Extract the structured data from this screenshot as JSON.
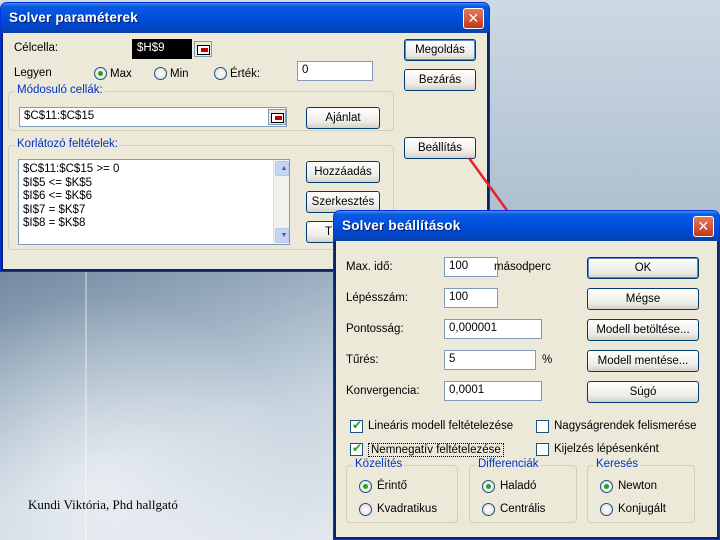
{
  "footer": {
    "caption": "Kundi Viktória, Phd hallgató"
  },
  "solver": {
    "title": "Solver paraméterek",
    "target_label": "Célcella:",
    "target_value": "$H$9",
    "equal_label": "Legyen",
    "max_label": "Max",
    "min_label": "Min",
    "value_label": "Érték:",
    "value_input": "0",
    "changing_label": "Módosuló cellák:",
    "changing_value": "$C$11:$C$15",
    "guess_button": "Ajánlat",
    "constraints_label": "Korlátozó feltételek:",
    "constraints": [
      "$C$11:$C$15 >= 0",
      "$I$5 <= $K$5",
      "$I$6 <= $K$6",
      "$I$7 = $K$7",
      "$I$8 = $K$8"
    ],
    "add_button": "Hozzáadás",
    "change_button": "Szerkesztés",
    "delete_button": "T",
    "solve_button": "Megoldás",
    "close_button": "Bezárás",
    "options_button": "Beállítás"
  },
  "options": {
    "title": "Solver beállítások",
    "max_time_label": "Max. idő:",
    "max_time_value": "100",
    "max_time_unit": "másodperc",
    "iterations_label": "Lépésszám:",
    "iterations_value": "100",
    "precision_label": "Pontosság:",
    "precision_value": "0,000001",
    "tolerance_label": "Tűrés:",
    "tolerance_value": "5",
    "tolerance_unit": "%",
    "convergence_label": "Konvergencia:",
    "convergence_value": "0,0001",
    "ok_button": "OK",
    "cancel_button": "Mégse",
    "load_button": "Modell betöltése...",
    "save_button": "Modell mentése...",
    "help_button": "Súgó",
    "linear_label": "Lineáris modell feltételezése",
    "nonneg_label": "Nemnegatív feltételezése",
    "scaling_label": "Nagyságrendek felismerése",
    "show_iter_label": "Kijelzés lépésenként",
    "estimates": {
      "title": "Közelítés",
      "opt1": "Érintő",
      "opt2": "Kvadratikus"
    },
    "derivatives": {
      "title": "Differenciák",
      "opt1": "Haladó",
      "opt2": "Centrális"
    },
    "search": {
      "title": "Keresés",
      "opt1": "Newton",
      "opt2": "Konjugált"
    }
  },
  "colors": {
    "titlebar": "#0052df",
    "arrow": "#e8202a",
    "checkmark": "#21a121"
  }
}
